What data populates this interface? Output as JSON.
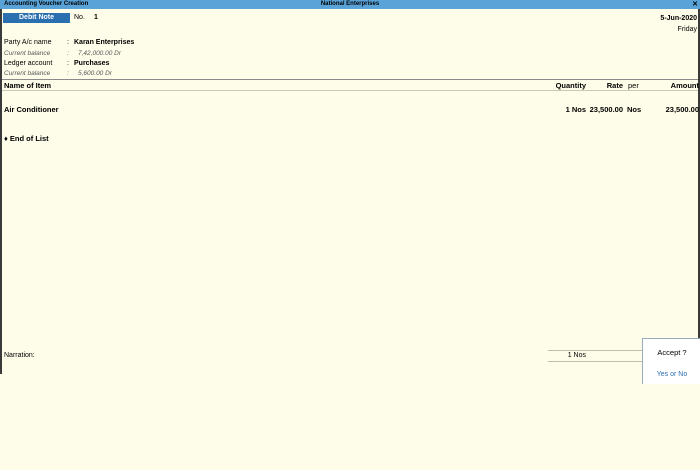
{
  "window": {
    "left_title": "Accounting Voucher  Creation",
    "company": "National Enterprises",
    "close_symbol": "✕"
  },
  "voucher": {
    "type": "Debit Note",
    "no_label": "No.",
    "no_value": "1",
    "date": "5-Jun-2020",
    "day": "Friday"
  },
  "party": {
    "label": "Party A/c name",
    "value": "Karan Enterprises",
    "bal_label": "Current balance",
    "bal_value": "7,42,000.00 Dr"
  },
  "ledger": {
    "label": "Ledger account",
    "value": "Purchases",
    "bal_label": "Current balance",
    "bal_value": "5,600.00 Dr"
  },
  "colon": ":",
  "columns": {
    "name": "Name of Item",
    "quantity": "Quantity",
    "rate": "Rate",
    "per": "per",
    "amount": "Amount"
  },
  "items": [
    {
      "name": "Air Conditioner",
      "quantity": "1 Nos",
      "rate": "23,500.00",
      "per": "Nos",
      "amount": "23,500.00"
    }
  ],
  "end_of_list": "♦ End of List",
  "narration_label": "Narration:",
  "total_quantity": "1 Nos",
  "accept": {
    "question": "Accept ?",
    "yes": "Yes",
    "or": "or",
    "no": "No"
  },
  "colors": {
    "background": "#fefde9",
    "titlebar": "#5aa3d8",
    "voucher_type_bg": "#2a6fb0"
  }
}
